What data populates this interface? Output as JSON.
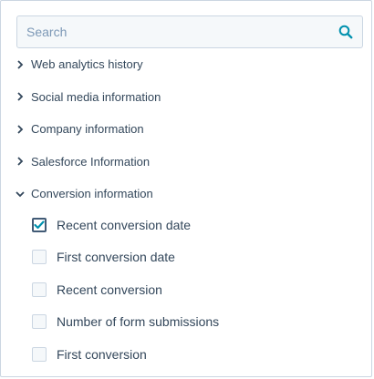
{
  "search": {
    "placeholder": "Search",
    "value": "",
    "icon": "search-icon"
  },
  "groups": [
    {
      "label": "Web analytics history",
      "expanded": false
    },
    {
      "label": "Social media information",
      "expanded": false
    },
    {
      "label": "Company information",
      "expanded": false
    },
    {
      "label": "Salesforce Information",
      "expanded": false
    },
    {
      "label": "Conversion information",
      "expanded": true
    }
  ],
  "options": [
    {
      "label": "Recent conversion date",
      "checked": true
    },
    {
      "label": "First conversion date",
      "checked": false
    },
    {
      "label": "Recent conversion",
      "checked": false
    },
    {
      "label": "Number of form submissions",
      "checked": false
    },
    {
      "label": "First conversion",
      "checked": false
    }
  ],
  "colors": {
    "text": "#33475b",
    "border": "#cbd6e2",
    "input_bg": "#f5f8fa",
    "accent": "#0091ae",
    "check": "#425b76"
  }
}
